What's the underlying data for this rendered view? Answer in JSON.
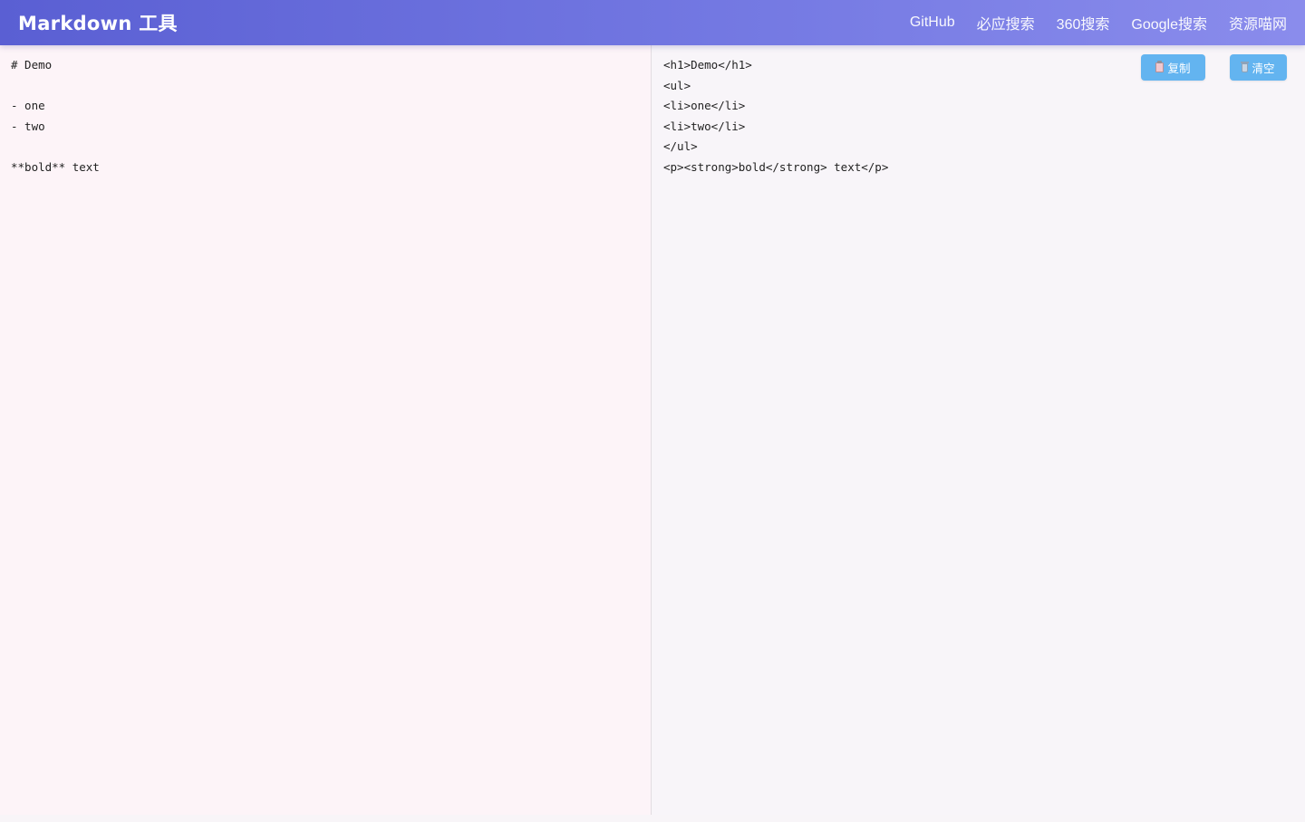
{
  "header": {
    "title": "Markdown 工具",
    "nav": [
      {
        "label": "GitHub"
      },
      {
        "label": "必应搜索"
      },
      {
        "label": "360搜索"
      },
      {
        "label": "Google搜索"
      },
      {
        "label": "资源喵网"
      }
    ]
  },
  "editor": {
    "value": "# Demo\n\n- one\n- two\n\n**bold** text"
  },
  "output": {
    "html": "<h1>Demo</h1>\n<ul>\n<li>one</li>\n<li>two</li>\n</ul>\n<p><strong>bold</strong> text</p>",
    "copy_label": "复制",
    "clear_label": "清空",
    "copy_icon": "clipboard-icon",
    "clear_icon": "trash-icon"
  },
  "colors": {
    "header_start": "#5a5fd3",
    "header_end": "#8a8cec",
    "button": "#63b4f0",
    "editor_bg": "#fdf4f8",
    "output_bg": "#f8f5f9"
  }
}
